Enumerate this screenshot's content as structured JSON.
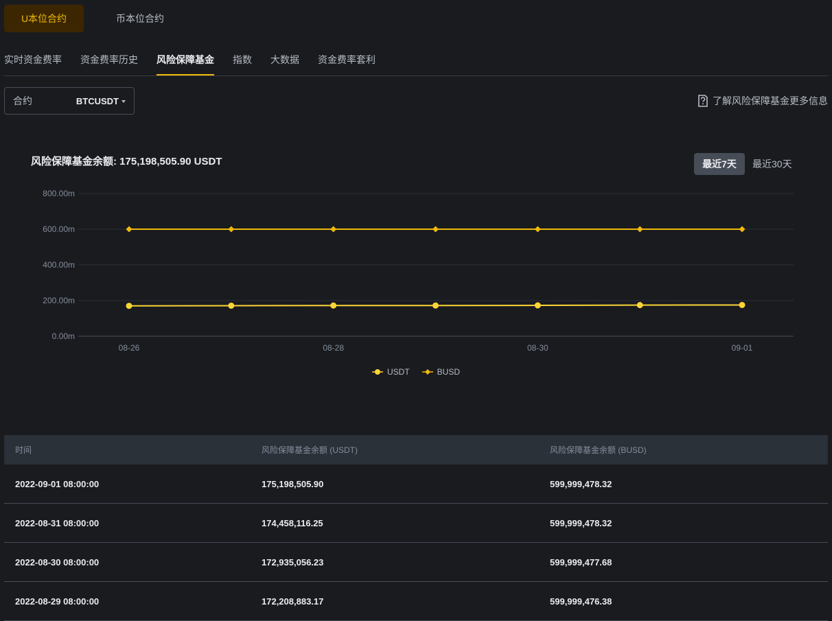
{
  "top_tabs": {
    "usdm": "U本位合约",
    "coinm": "币本位合约"
  },
  "sub_tabs": [
    "实时资金费率",
    "资金费率历史",
    "风险保障基金",
    "指数",
    "大数据",
    "资金费率套利"
  ],
  "contract": {
    "label": "合约",
    "value": "BTCUSDT"
  },
  "info_link": "了解风险保障基金更多信息",
  "fund": {
    "title_label": "风险保障基金余额:",
    "title_value": "175,198,505.90 USDT"
  },
  "range": {
    "seven_days": "最近7天",
    "thirty_days": "最近30天"
  },
  "chart_data": {
    "type": "line",
    "x": [
      "08-26",
      "08-27",
      "08-28",
      "08-29",
      "08-30",
      "08-31",
      "09-01"
    ],
    "x_tick_labels": [
      "08-26",
      "08-28",
      "08-30",
      "09-01"
    ],
    "y_tick_labels": [
      "0.00m",
      "200.00m",
      "400.00m",
      "600.00m",
      "800.00m"
    ],
    "ylim": [
      0,
      800
    ],
    "grid": true,
    "legend_placement": "bottom-center",
    "series": [
      {
        "name": "USDT",
        "color": "#fcd535",
        "marker": "circle",
        "values": [
          170.4,
          171.3,
          172.1,
          172.2,
          172.9,
          174.5,
          175.2
        ]
      },
      {
        "name": "BUSD",
        "color": "#f0b90b",
        "marker": "diamond",
        "values": [
          599.99,
          599.99,
          599.99,
          599.99,
          599.99,
          599.99,
          599.99
        ]
      }
    ]
  },
  "table": {
    "headers": [
      "时间",
      "风险保障基金余额 (USDT)",
      "风险保障基金余额 (BUSD)"
    ],
    "rows": [
      [
        "2022-09-01 08:00:00",
        "175,198,505.90",
        "599,999,478.32"
      ],
      [
        "2022-08-31 08:00:00",
        "174,458,116.25",
        "599,999,478.32"
      ],
      [
        "2022-08-30 08:00:00",
        "172,935,056.23",
        "599,999,477.68"
      ],
      [
        "2022-08-29 08:00:00",
        "172,208,883.17",
        "599,999,476.38"
      ]
    ]
  }
}
